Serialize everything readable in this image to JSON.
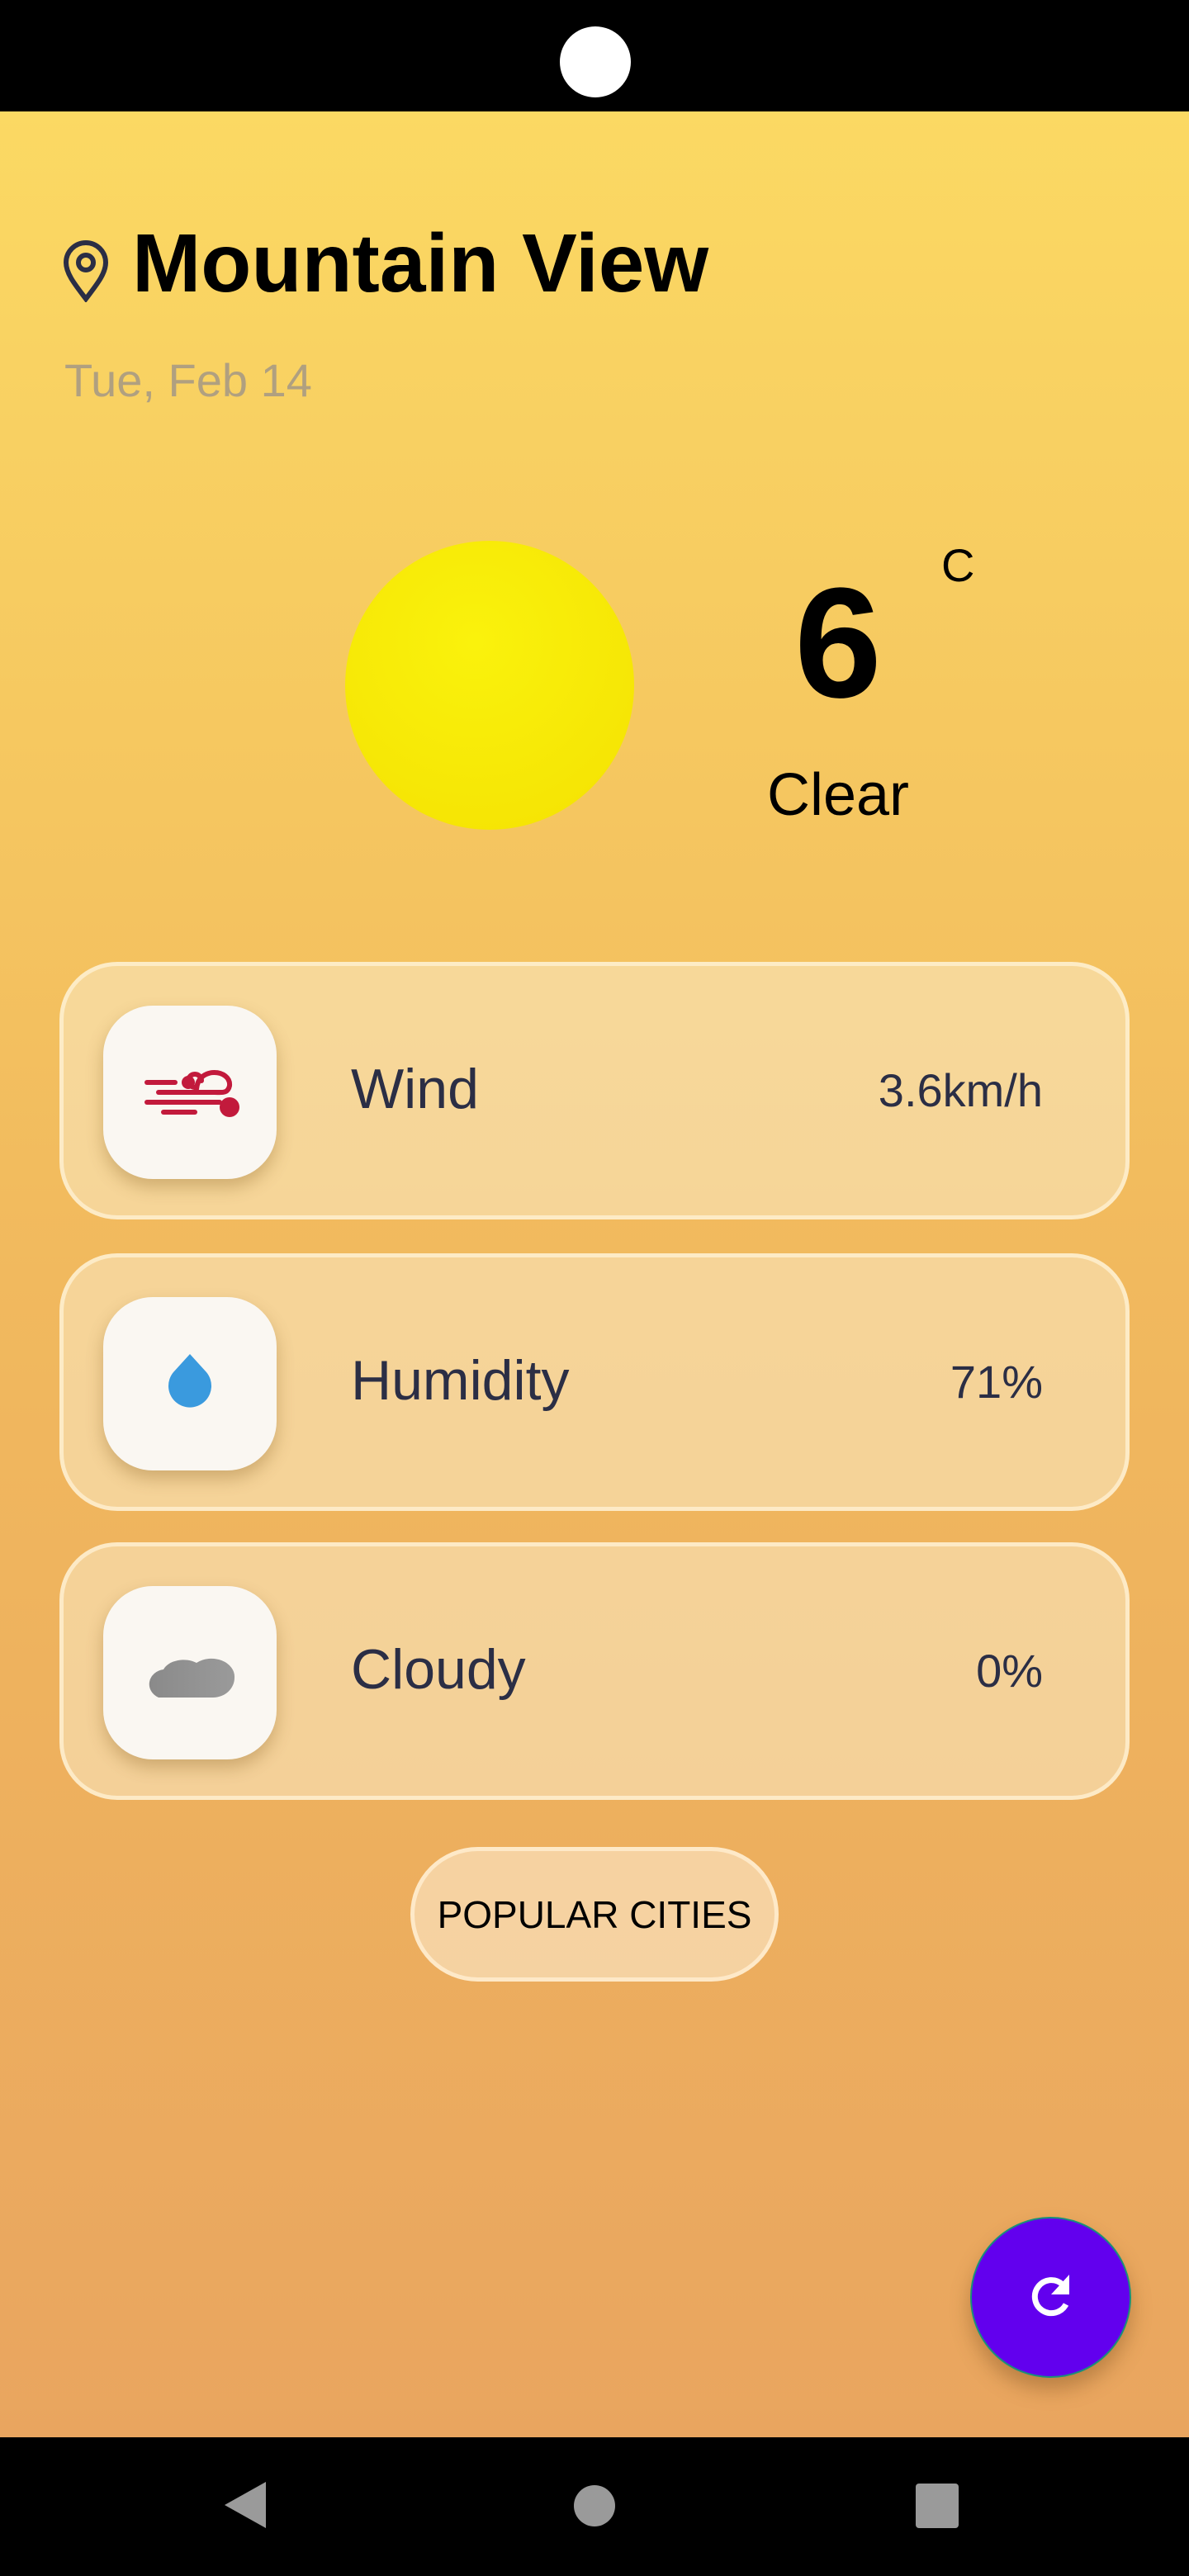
{
  "location": {
    "city": "Mountain View",
    "date": "Tue, Feb 14"
  },
  "current": {
    "temperature": "6",
    "unit": "C",
    "condition": "Clear"
  },
  "details": [
    {
      "label": "Wind",
      "value": "3.6km/h",
      "icon": "wind-icon",
      "color": "#c21a3c"
    },
    {
      "label": "Humidity",
      "value": "71%",
      "icon": "water-drop-icon",
      "color": "#3a9ade"
    },
    {
      "label": "Cloudy",
      "value": "0%",
      "icon": "cloud-icon",
      "color": "#8e8e8e"
    }
  ],
  "popular_cities_label": "POPULAR CITIES",
  "fab": {
    "icon": "refresh-icon",
    "color": "#6200ee"
  }
}
